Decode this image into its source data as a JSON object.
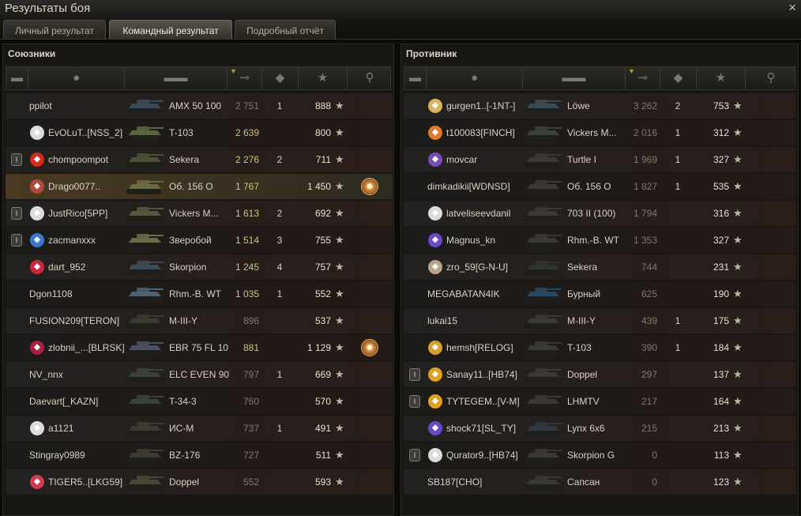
{
  "window": {
    "title": "Результаты боя",
    "close_icon": "×"
  },
  "tabs": [
    {
      "label": "Личный результат",
      "active": false
    },
    {
      "label": "Командный результат",
      "active": true
    },
    {
      "label": "Подробный отчёт",
      "active": false
    }
  ],
  "columns": {
    "platoon_icon": "▬",
    "player_icon": "●",
    "tank_icon": "▬▬",
    "damage_icon": "⊸",
    "kills_icon": "◆",
    "xp_icon": "★",
    "medal_icon": "⚲"
  },
  "allies": {
    "title": "Союзники",
    "rows": [
      {
        "name": "ppilot",
        "tank": "AMX 50 100",
        "damage": "2 751",
        "damage_dim": true,
        "kills": "1",
        "xp": "888",
        "platoon": false,
        "clan": false,
        "clan_color": "",
        "medal": false,
        "tank_color": "#3c4a55",
        "highlight": false
      },
      {
        "name": "EvOLuT..[NSS_2]",
        "tank": "T-103",
        "damage": "2 639",
        "damage_dim": false,
        "kills": "",
        "xp": "800",
        "platoon": false,
        "clan": true,
        "clan_color": "#dcdcdc",
        "medal": false,
        "tank_color": "#5a6640",
        "highlight": false
      },
      {
        "name": "chompoompot",
        "tank": "Sekera",
        "damage": "2 276",
        "damage_dim": false,
        "kills": "2",
        "xp": "711",
        "platoon": true,
        "clan": true,
        "clan_color": "#d42a1e",
        "medal": false,
        "tank_color": "#4a5036",
        "highlight": false
      },
      {
        "name": "Drago0077..",
        "tank": "Об. 156 О",
        "damage": "1 767",
        "damage_dim": false,
        "kills": "",
        "xp": "1 450",
        "platoon": false,
        "clan": true,
        "clan_color": "#b14a3a",
        "medal": true,
        "tank_color": "#6a6a44",
        "highlight": true
      },
      {
        "name": "JustRico[5PP]",
        "tank": "Vickers M...",
        "damage": "1 613",
        "damage_dim": false,
        "kills": "2",
        "xp": "692",
        "platoon": true,
        "clan": true,
        "clan_color": "#dcdcdc",
        "medal": false,
        "tank_color": "#56563e",
        "highlight": false
      },
      {
        "name": "zacmanxxx",
        "tank": "Зверобой",
        "damage": "1 514",
        "damage_dim": false,
        "kills": "3",
        "xp": "755",
        "platoon": true,
        "clan": true,
        "clan_color": "#3a7ac8",
        "medal": false,
        "tank_color": "#6a6a4a",
        "highlight": false
      },
      {
        "name": "dart_952",
        "tank": "Skorpion",
        "damage": "1 245",
        "damage_dim": false,
        "kills": "4",
        "xp": "757",
        "platoon": false,
        "clan": true,
        "clan_color": "#c8283a",
        "medal": false,
        "tank_color": "#3e4a55",
        "highlight": false
      },
      {
        "name": "Dgon1108",
        "tank": "Rhm.-B. WT",
        "damage": "1 035",
        "damage_dim": false,
        "kills": "1",
        "xp": "552",
        "platoon": false,
        "clan": false,
        "clan_color": "",
        "medal": false,
        "tank_color": "#506070",
        "highlight": false
      },
      {
        "name": "FUSION209[TERON]",
        "tank": "M-III-Y",
        "damage": "896",
        "damage_dim": true,
        "kills": "",
        "xp": "537",
        "platoon": false,
        "clan": false,
        "clan_color": "",
        "medal": false,
        "tank_color": "#3a3a30",
        "highlight": false
      },
      {
        "name": "zlobnii_...[BLRSK]",
        "tank": "EBR 75 FL 10",
        "damage": "881",
        "damage_dim": false,
        "kills": "",
        "xp": "1 129",
        "platoon": false,
        "clan": true,
        "clan_color": "#a82040",
        "medal": true,
        "tank_color": "#4a5060",
        "highlight": false
      },
      {
        "name": "NV_nnx",
        "tank": "ELC EVEN 90",
        "damage": "797",
        "damage_dim": true,
        "kills": "1",
        "xp": "669",
        "platoon": false,
        "clan": false,
        "clan_color": "",
        "medal": false,
        "tank_color": "#3a4238",
        "highlight": false
      },
      {
        "name": "Daevart[_KAZN]",
        "tank": "T-34-3",
        "damage": "760",
        "damage_dim": true,
        "kills": "",
        "xp": "570",
        "platoon": false,
        "clan": false,
        "clan_color": "",
        "medal": false,
        "tank_color": "#3a4238",
        "highlight": false
      },
      {
        "name": "a1121",
        "tank": "ИС-М",
        "damage": "737",
        "damage_dim": true,
        "kills": "1",
        "xp": "491",
        "platoon": false,
        "clan": true,
        "clan_color": "#dcdcdc",
        "medal": false,
        "tank_color": "#3c3c32",
        "highlight": false
      },
      {
        "name": "Stingray0989",
        "tank": "BZ-176",
        "damage": "727",
        "damage_dim": true,
        "kills": "",
        "xp": "511",
        "platoon": false,
        "clan": false,
        "clan_color": "",
        "medal": false,
        "tank_color": "#3c3c32",
        "highlight": false
      },
      {
        "name": "TIGER5..[LKG59]",
        "tank": "Doppel",
        "damage": "552",
        "damage_dim": true,
        "kills": "",
        "xp": "593",
        "platoon": false,
        "clan": true,
        "clan_color": "#d23a50",
        "medal": false,
        "tank_color": "#4a4638",
        "highlight": false
      }
    ]
  },
  "enemies": {
    "title": "Противник",
    "rows": [
      {
        "name": "gurgen1..[-1NT-]",
        "tank": "Löwe",
        "damage": "3 262",
        "damage_dim": true,
        "kills": "2",
        "xp": "753",
        "platoon": false,
        "clan": true,
        "clan_color": "#d8b45a",
        "tank_color": "#3a4a55"
      },
      {
        "name": "t100083[FINCH]",
        "tank": "Vickers M...",
        "damage": "2 016",
        "damage_dim": true,
        "kills": "1",
        "xp": "312",
        "platoon": false,
        "clan": true,
        "clan_color": "#e07a2a",
        "tank_color": "#3a4238"
      },
      {
        "name": "movcar",
        "tank": "Turtle I",
        "damage": "1 969",
        "damage_dim": true,
        "kills": "1",
        "xp": "327",
        "platoon": false,
        "clan": true,
        "clan_color": "#7a4ab8",
        "tank_color": "#3a3a32"
      },
      {
        "name": "dimkadikii[WDNSD]",
        "tank": "Об. 156 О",
        "damage": "1 827",
        "damage_dim": true,
        "kills": "1",
        "xp": "535",
        "platoon": false,
        "clan": false,
        "clan_color": "",
        "tank_color": "#3a3a32"
      },
      {
        "name": "latveliseevdanil",
        "tank": "703 II (100)",
        "damage": "1 794",
        "damage_dim": true,
        "kills": "",
        "xp": "316",
        "platoon": false,
        "clan": true,
        "clan_color": "#dcdcdc",
        "tank_color": "#3a3a32"
      },
      {
        "name": "Magnus_kn",
        "tank": "Rhm.-B. WT",
        "damage": "1 353",
        "damage_dim": true,
        "kills": "",
        "xp": "327",
        "platoon": false,
        "clan": true,
        "clan_color": "#6a4ac8",
        "tank_color": "#3a3a32"
      },
      {
        "name": "zro_59[G-N-U]",
        "tank": "Sekera",
        "damage": "744",
        "damage_dim": true,
        "kills": "",
        "xp": "231",
        "platoon": false,
        "clan": true,
        "clan_color": "#b8a48a",
        "tank_color": "#2e3430"
      },
      {
        "name": "MEGABATAN4IK",
        "tank": "Бурный",
        "damage": "625",
        "damage_dim": true,
        "kills": "",
        "xp": "190",
        "platoon": false,
        "clan": false,
        "clan_color": "",
        "tank_color": "#2a4660"
      },
      {
        "name": "lukai15",
        "tank": "M-III-Y",
        "damage": "439",
        "damage_dim": true,
        "kills": "1",
        "xp": "175",
        "platoon": false,
        "clan": false,
        "clan_color": "",
        "tank_color": "#3a3a32"
      },
      {
        "name": "hemsh[RELOG]",
        "tank": "T-103",
        "damage": "390",
        "damage_dim": true,
        "kills": "1",
        "xp": "184",
        "platoon": false,
        "clan": true,
        "clan_color": "#d8a030",
        "tank_color": "#3a3a32"
      },
      {
        "name": "Sanay11..[HB74]",
        "tank": "Doppel",
        "damage": "297",
        "damage_dim": true,
        "kills": "",
        "xp": "137",
        "platoon": true,
        "clan": true,
        "clan_color": "#e0a020",
        "tank_color": "#3a3a32"
      },
      {
        "name": "TYTEGEM..[V-M]",
        "tank": "LHMTV",
        "damage": "217",
        "damage_dim": true,
        "kills": "",
        "xp": "164",
        "platoon": true,
        "clan": true,
        "clan_color": "#e0a020",
        "tank_color": "#3a3a32"
      },
      {
        "name": "shock71[SL_TY]",
        "tank": "Lynx 6x6",
        "damage": "215",
        "damage_dim": true,
        "kills": "",
        "xp": "213",
        "platoon": false,
        "clan": true,
        "clan_color": "#6a4ac8",
        "tank_color": "#2e3a40"
      },
      {
        "name": "Qurator9..[HB74]",
        "tank": "Skorpion G",
        "damage": "0",
        "damage_dim": true,
        "kills": "",
        "xp": "113",
        "platoon": true,
        "clan": true,
        "clan_color": "#dcdcdc",
        "tank_color": "#3a3a32"
      },
      {
        "name": "SB187[CHO]",
        "tank": "Сапсан",
        "damage": "0",
        "damage_dim": true,
        "kills": "",
        "xp": "123",
        "platoon": false,
        "clan": false,
        "clan_color": "",
        "tank_color": "#3a3a32"
      }
    ]
  },
  "star_icon": "★",
  "medal_icon": "✸",
  "platoon_icon": "I",
  "clan_icon": "◆"
}
